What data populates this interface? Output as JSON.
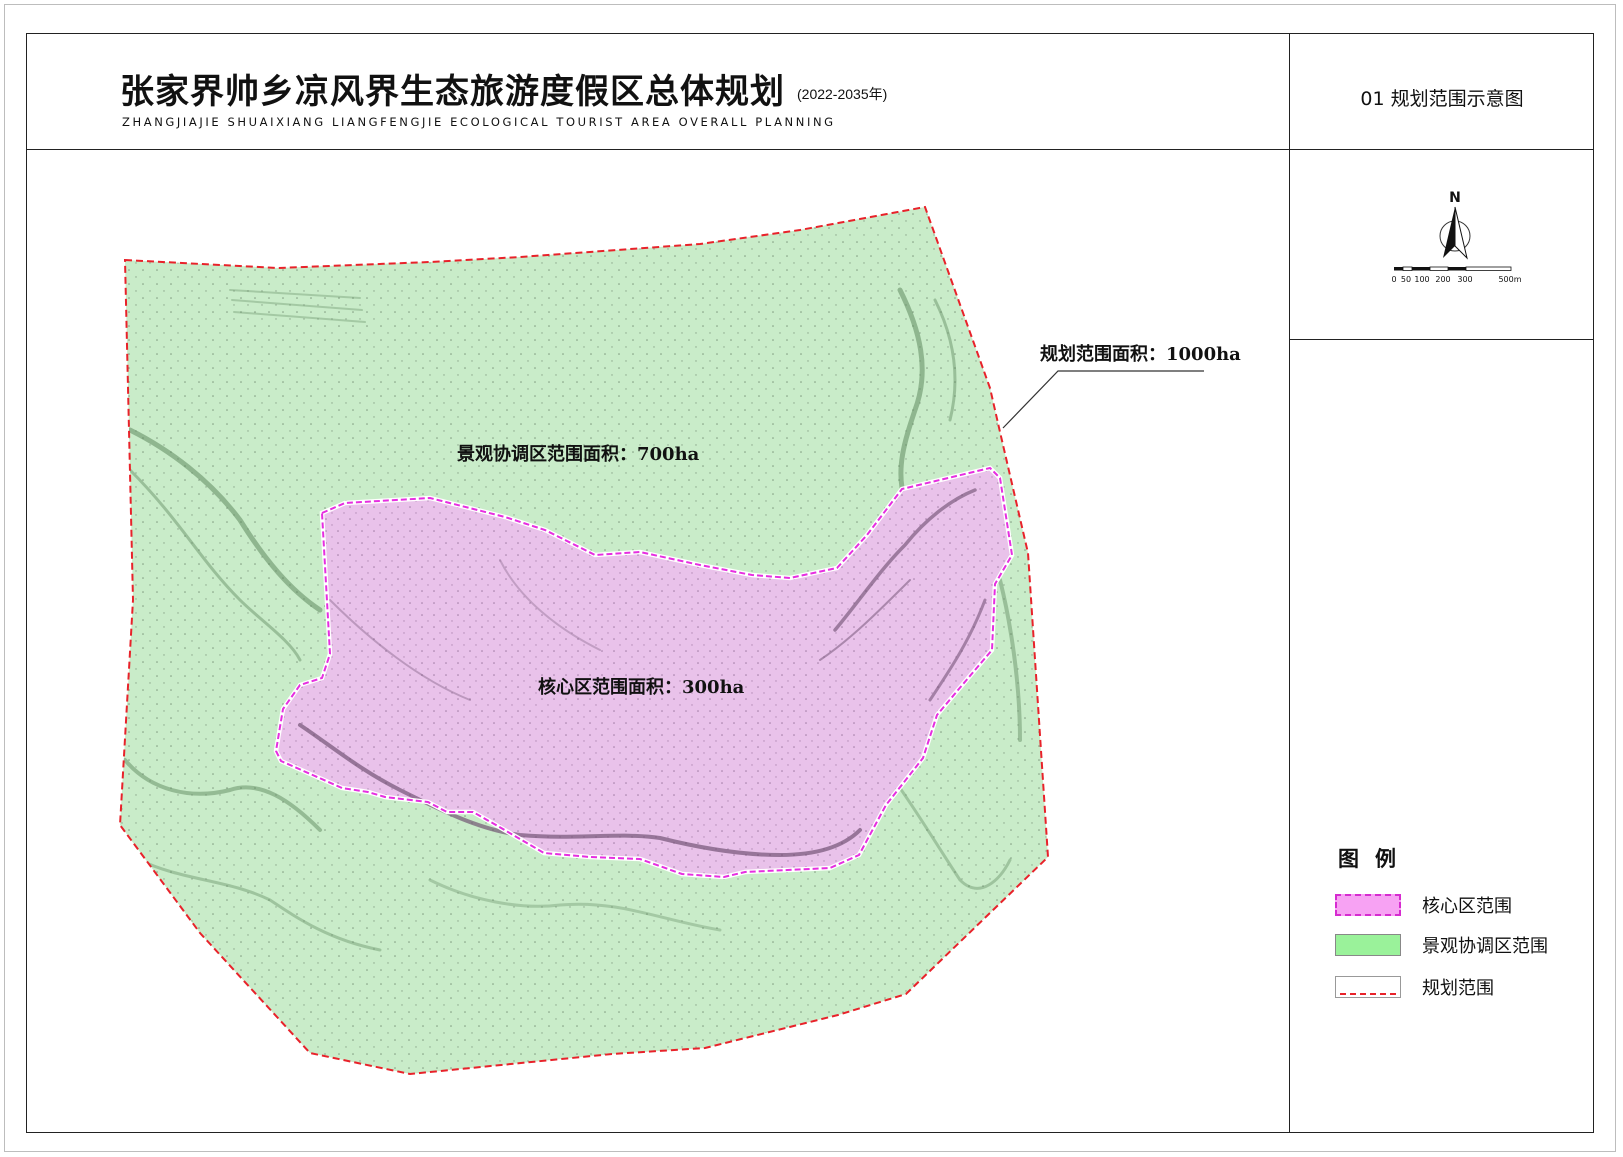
{
  "header": {
    "title_cn": "张家界帅乡凉风界生态旅游度假区总体规划",
    "title_years": "(2022-2035年)",
    "title_en": "ZHANGJIAJIE SHUAIXIANG LIANGFENGJIE ECOLOGICAL TOURIST AREA OVERALL PLANNING",
    "sheet_title": "01 规划范围示意图"
  },
  "north_arrow": {
    "label": "N"
  },
  "scale_bar": {
    "ticks": [
      "0",
      "50",
      "100",
      "200",
      "300",
      "500m"
    ]
  },
  "map": {
    "labels": {
      "planning_area": "规划范围面积：1000ha",
      "coordination_area": "景观协调区范围面积：700ha",
      "core_area": "核心区范围面积：300ha"
    }
  },
  "legend": {
    "title": "图例",
    "items": [
      {
        "label": "核心区范围",
        "color": "#f7a2f3",
        "border_color": "#d62bd0"
      },
      {
        "label": "景观协调区范围",
        "color": "#9af29a"
      },
      {
        "label": "规划范围",
        "border_color": "#e8222a"
      }
    ]
  },
  "colors": {
    "coordination_fill": "#c9ecc9",
    "core_fill": "#e9c2ea",
    "boundary_line": "#e8222a",
    "core_line": "#e62ee0"
  }
}
